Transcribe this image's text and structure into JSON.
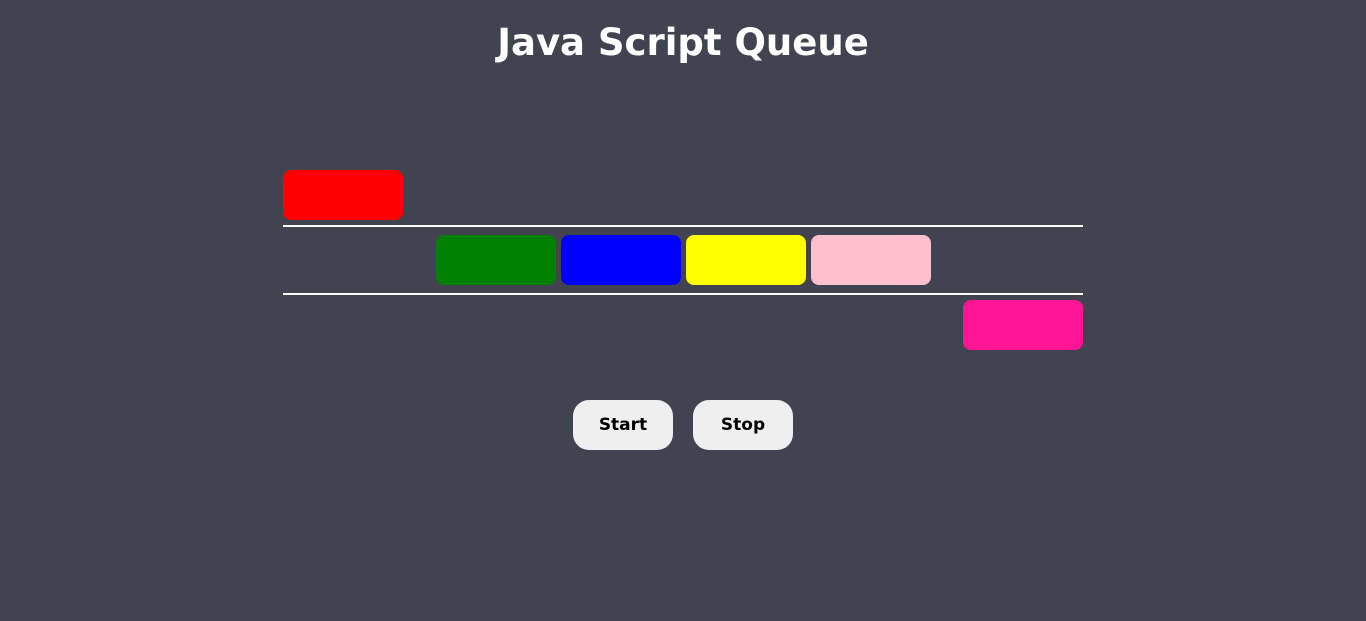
{
  "header": {
    "title": "Java Script Queue"
  },
  "queue": {
    "dequeued_item": {
      "color": "#ff0000",
      "color_name": "red"
    },
    "items": [
      {
        "color": "#008000",
        "color_name": "green"
      },
      {
        "color": "#0000ff",
        "color_name": "blue"
      },
      {
        "color": "#ffff00",
        "color_name": "yellow"
      },
      {
        "color": "#ffc0cb",
        "color_name": "pink"
      }
    ],
    "incoming_item": {
      "color": "#ff1493",
      "color_name": "deeppink"
    },
    "line_color": "#ffffff"
  },
  "controls": {
    "start_label": "Start",
    "stop_label": "Stop"
  },
  "theme": {
    "background": "#424351",
    "button_background": "#efefef"
  }
}
